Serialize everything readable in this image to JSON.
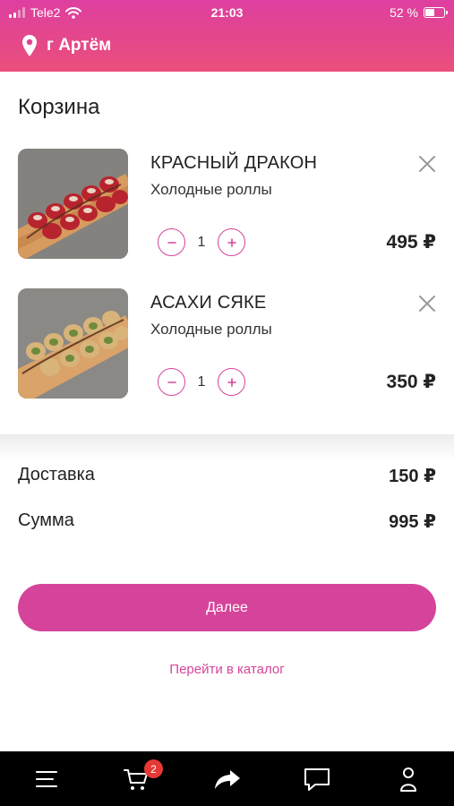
{
  "status_bar": {
    "carrier": "Tele2",
    "time": "21:03",
    "battery": "52 %",
    "battery_level": 0.52
  },
  "header": {
    "location": "г Артём"
  },
  "cart": {
    "title": "Корзина",
    "items": [
      {
        "name": "КРАСНЫЙ ДРАКОН",
        "category": "Холодные роллы",
        "quantity": "1",
        "price": "495 ₽"
      },
      {
        "name": "АСАХИ СЯКЕ",
        "category": "Холодные роллы",
        "quantity": "1",
        "price": "350 ₽"
      }
    ]
  },
  "summary": {
    "delivery_label": "Доставка",
    "delivery_value": "150 ₽",
    "total_label": "Сумма",
    "total_value": "995 ₽"
  },
  "actions": {
    "next_label": "Далее",
    "catalog_label": "Перейти в каталог"
  },
  "bottom_nav": {
    "cart_badge": "2",
    "items": [
      "menu-icon",
      "cart-icon",
      "share-icon",
      "chat-icon",
      "profile-icon"
    ]
  },
  "colors": {
    "accent": "#d5449a",
    "header_gradient_start": "#de3fa0",
    "header_gradient_end": "#ea4f7a",
    "badge": "#e53935"
  }
}
